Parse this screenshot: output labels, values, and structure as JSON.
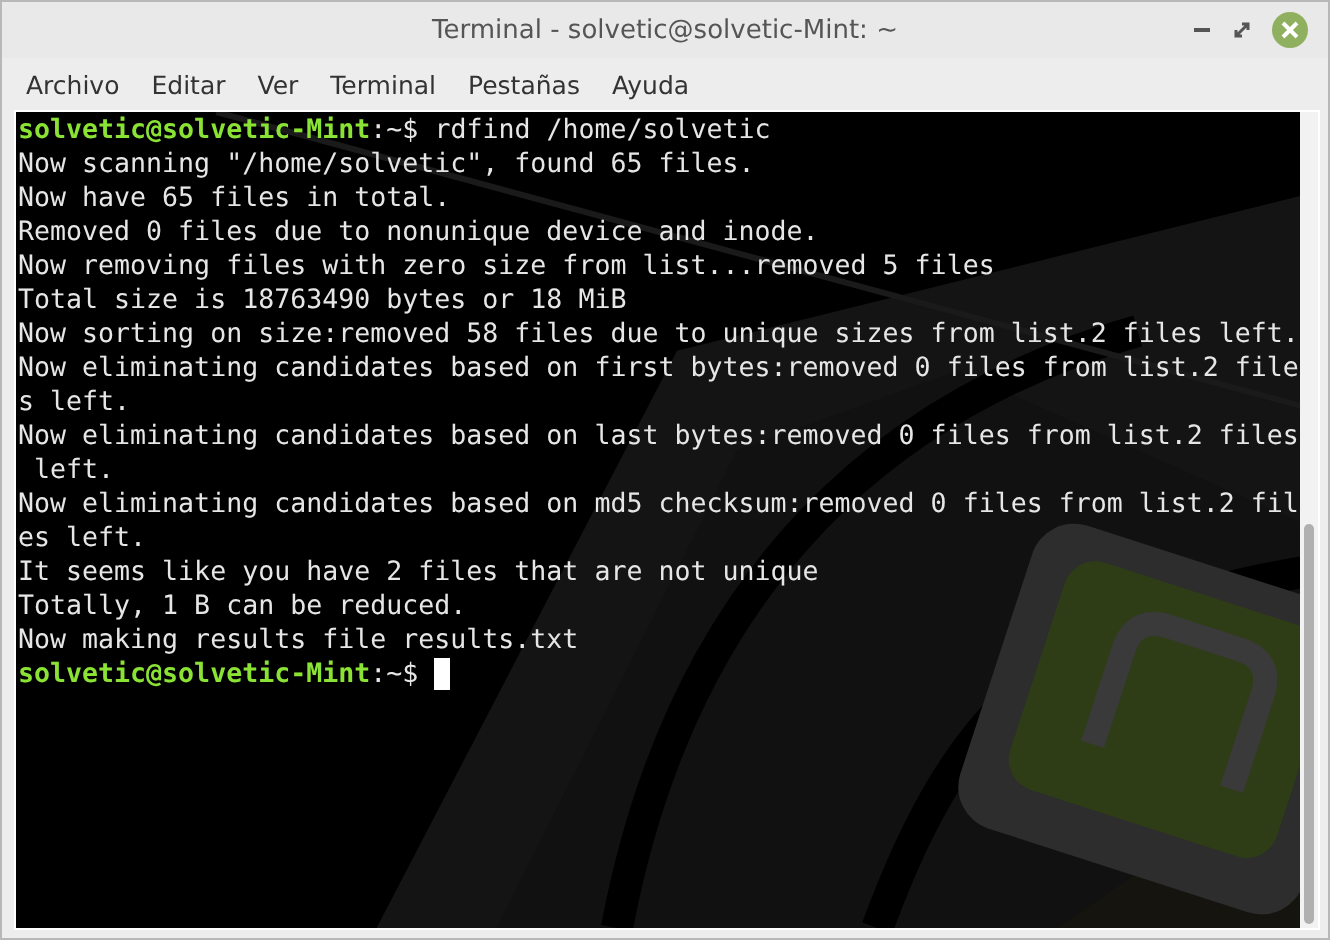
{
  "window": {
    "title": "Terminal - solvetic@solvetic-Mint: ~"
  },
  "menu": [
    "Archivo",
    "Editar",
    "Ver",
    "Terminal",
    "Pestañas",
    "Ayuda"
  ],
  "terminal": {
    "lines": [
      {
        "kind": "prompt",
        "user_host": "solvetic@solvetic-Mint",
        "separator": ":",
        "path": "~",
        "symbol": "$",
        "command": "rdfind /home/solvetic",
        "cursor": false
      },
      {
        "kind": "output",
        "text": "Now scanning \"/home/solvetic\", found 65 files."
      },
      {
        "kind": "output",
        "text": "Now have 65 files in total."
      },
      {
        "kind": "output",
        "text": "Removed 0 files due to nonunique device and inode."
      },
      {
        "kind": "output",
        "text": "Now removing files with zero size from list...removed 5 files"
      },
      {
        "kind": "output",
        "text": "Total size is 18763490 bytes or 18 MiB"
      },
      {
        "kind": "output",
        "text": "Now sorting on size:removed 58 files due to unique sizes from list.2 files left."
      },
      {
        "kind": "output",
        "text": "Now eliminating candidates based on first bytes:removed 0 files from list.2 file"
      },
      {
        "kind": "output",
        "text": "s left."
      },
      {
        "kind": "output",
        "text": "Now eliminating candidates based on last bytes:removed 0 files from list.2 files"
      },
      {
        "kind": "output",
        "text": " left."
      },
      {
        "kind": "output",
        "text": "Now eliminating candidates based on md5 checksum:removed 0 files from list.2 fil"
      },
      {
        "kind": "output",
        "text": "es left."
      },
      {
        "kind": "output",
        "text": "It seems like you have 2 files that are not unique"
      },
      {
        "kind": "output",
        "text": "Totally, 1 B can be reduced."
      },
      {
        "kind": "output",
        "text": "Now making results file results.txt"
      },
      {
        "kind": "prompt",
        "user_host": "solvetic@solvetic-Mint",
        "separator": ":",
        "path": "~",
        "symbol": "$",
        "cursor": true
      }
    ]
  }
}
